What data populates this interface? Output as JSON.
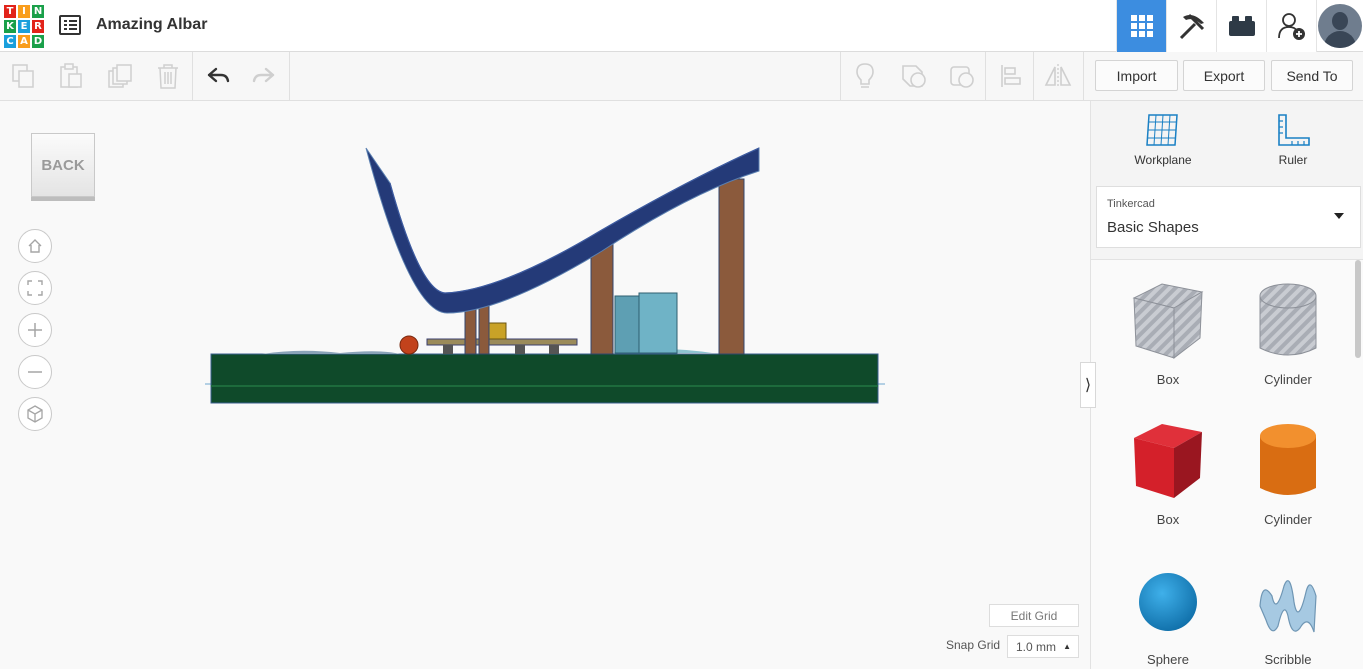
{
  "app": {
    "logo_letters": [
      "T",
      "I",
      "N",
      "K",
      "E",
      "R",
      "C",
      "A",
      "D"
    ],
    "logo_colors": [
      "#e2231a",
      "#f99d1c",
      "#1aa04a",
      "#1aa04a",
      "#1a9fdc",
      "#e2231a",
      "#1a9fdc",
      "#f99d1c",
      "#1aa04a"
    ],
    "document_title": "Amazing Albar"
  },
  "topbar_right": {
    "items": [
      {
        "icon": "grid-view-icon",
        "active": true
      },
      {
        "icon": "pickaxe-icon",
        "active": false
      },
      {
        "icon": "bricks-icon",
        "active": false
      },
      {
        "icon": "add-user-icon",
        "active": false
      }
    ],
    "accent": "#3c8de0"
  },
  "toolbar": {
    "left_icons": [
      "copy-icon",
      "paste-icon",
      "duplicate-icon",
      "delete-icon",
      "undo-icon",
      "redo-icon"
    ],
    "right_icons": [
      "lightbulb-icon",
      "shape-solid-icon",
      "shape-hole-icon",
      "align-icon",
      "mirror-icon"
    ],
    "import_label": "Import",
    "export_label": "Export",
    "send_to_label": "Send To"
  },
  "canvas": {
    "back_label": "BACK",
    "nav_icons": [
      "home-icon",
      "fit-view-icon",
      "zoom-in-icon",
      "zoom-out-icon",
      "perspective-cube-icon"
    ],
    "edit_grid_label": "Edit Grid",
    "snap_grid_label": "Snap Grid",
    "snap_grid_value": "1.0 mm",
    "colors": {
      "base": "#0f4a2a",
      "ramp": "#243a78",
      "posts": "#8b5a3c",
      "wall": "#5e9fb3"
    }
  },
  "right_panel": {
    "workplane_label": "Workplane",
    "ruler_label": "Ruler",
    "library_category": "Tinkercad",
    "library_name": "Basic Shapes",
    "shapes": [
      {
        "label": "Box",
        "style": "hole",
        "color": "#b9bec6"
      },
      {
        "label": "Cylinder",
        "style": "hole",
        "color": "#b9bec6"
      },
      {
        "label": "Box",
        "style": "solid",
        "color": "#d4202a"
      },
      {
        "label": "Cylinder",
        "style": "solid",
        "color": "#ea7c1a"
      },
      {
        "label": "Sphere",
        "style": "solid",
        "color": "#1a90d0"
      },
      {
        "label": "Scribble",
        "style": "solid",
        "color": "#a6c9e2"
      }
    ]
  }
}
